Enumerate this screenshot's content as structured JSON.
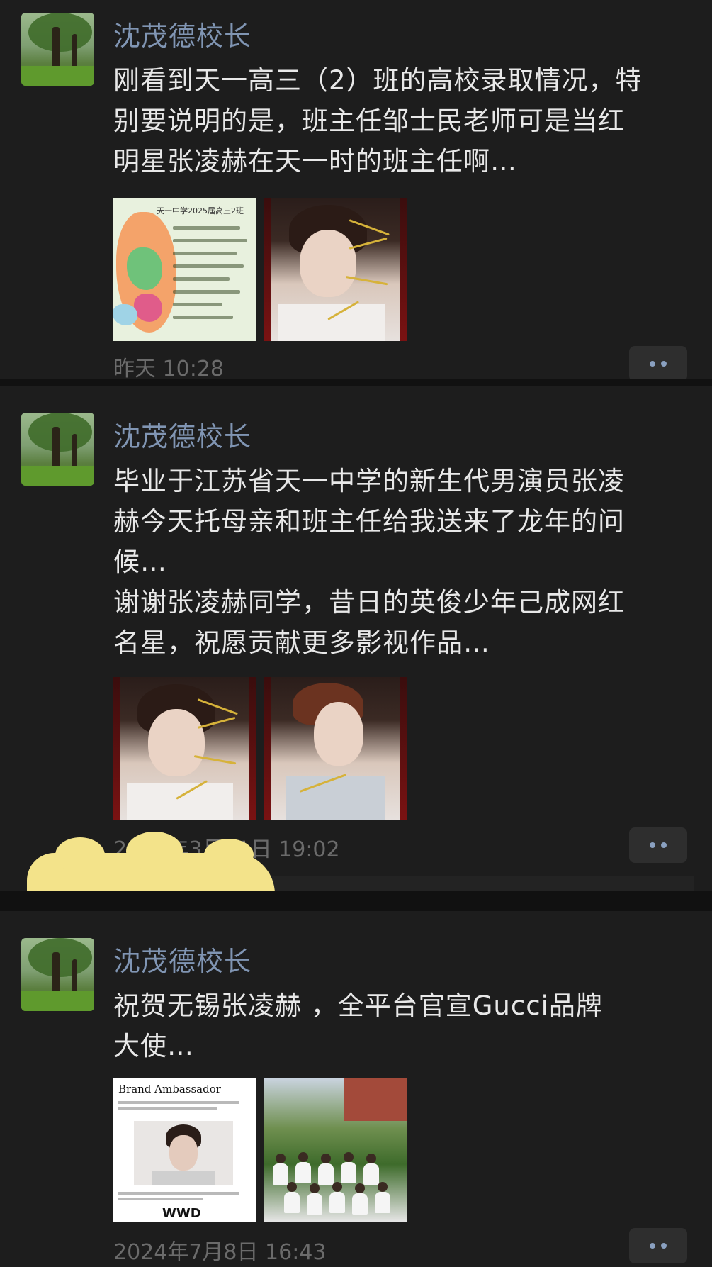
{
  "posts": [
    {
      "author": "沈茂德校长",
      "text": "刚看到天一高三（2）班的高校录取情况，特\n别要说明的是，班主任邹士民老师可是当红\n明星张凌赫在天一时的班主任啊…",
      "time": "昨天 10:28",
      "images": [
        "admission-map-image",
        "portrait-image"
      ]
    },
    {
      "author": "沈茂德校长",
      "text": "毕业于江苏省天一中学的新生代男演员张凌\n赫今天托母亲和班主任给我送来了龙年的问\n候…\n谢谢张凌赫同学，昔日的英俊少年己成网红\n名星，祝愿贡献更多影视作品…",
      "time": "2024年3月21日 19:02",
      "images": [
        "portrait-image",
        "side-portrait-image"
      ]
    },
    {
      "author": "沈茂德校长",
      "text": "祝贺无锡张凌赫 ，全平台官宣Gucci品牌\n大使…",
      "time": "2024年7月8日 16:43",
      "images": [
        "news-article-image",
        "class-photo-image"
      ]
    }
  ],
  "thumb_text": {
    "map_title": "天一中学2025届高三2班",
    "news_heading": "Brand Ambassador",
    "news_logo": "WWD"
  },
  "colors": {
    "background": "#1d1d1d",
    "author_name": "#8095b3",
    "body_text": "#e8e8e8",
    "timestamp": "#6b6b6b",
    "more_dots": "#8aa0c0"
  },
  "icons": {
    "more_button": "two-dots-icon"
  }
}
